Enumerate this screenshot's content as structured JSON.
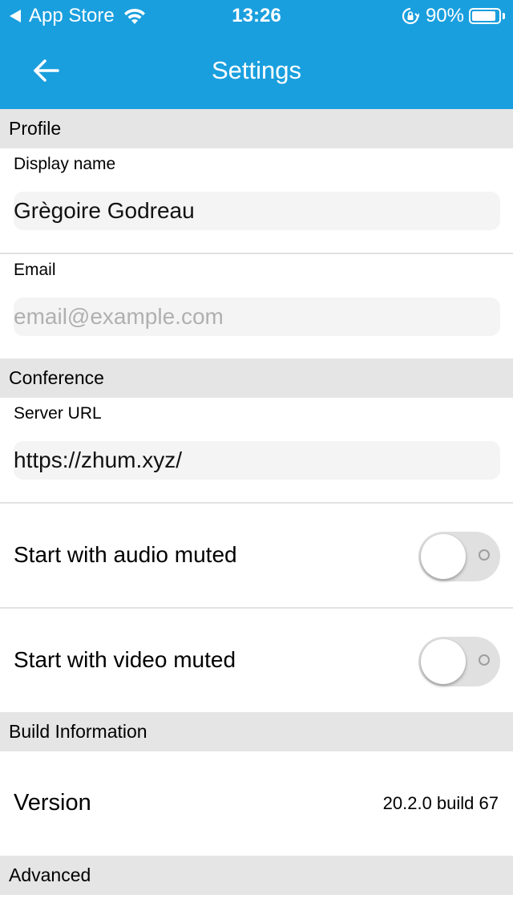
{
  "status_bar": {
    "carrier": "App Store",
    "time": "13:26",
    "battery_percent": "90%",
    "battery_level": 0.9,
    "icons": [
      "back-triangle-icon",
      "wifi-icon",
      "rotation-lock-icon",
      "battery-icon"
    ]
  },
  "navbar": {
    "title": "Settings",
    "back_icon": "arrow-left-icon",
    "color": "#1a9fde"
  },
  "sections": {
    "profile": {
      "header": "Profile",
      "display_name": {
        "label": "Display name",
        "value": "Grègoire Godreau",
        "placeholder": ""
      },
      "email": {
        "label": "Email",
        "value": "",
        "placeholder": "email@example.com"
      }
    },
    "conference": {
      "header": "Conference",
      "server_url": {
        "label": "Server URL",
        "value": "https://zhum.xyz/",
        "placeholder": ""
      },
      "audio_muted": {
        "label": "Start with audio muted",
        "on": false
      },
      "video_muted": {
        "label": "Start with video muted",
        "on": false
      }
    },
    "build": {
      "header": "Build Information",
      "version_label": "Version",
      "version_value": "20.2.0 build 67"
    },
    "advanced": {
      "header": "Advanced"
    }
  }
}
